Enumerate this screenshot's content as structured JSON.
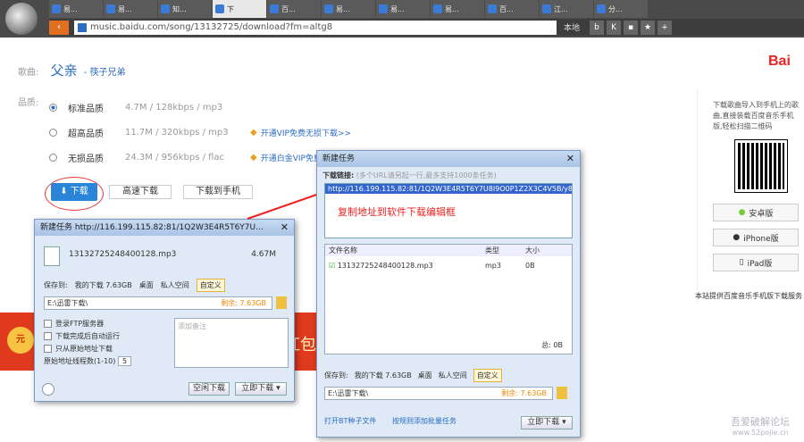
{
  "browser": {
    "url": "music.baidu.com/song/13132725/download?fm=altg8",
    "tabs": [
      "易...",
      "易...",
      "知...",
      "下",
      "百...",
      "易...",
      "易...",
      "易...",
      "百...",
      "江...",
      "分..."
    ],
    "search_hint": "本地"
  },
  "song": {
    "label": "歌曲:",
    "title": "父亲",
    "artist": "筷子兄弟",
    "quality_label": "品质:"
  },
  "qualities": [
    {
      "name": "标准品质",
      "info": "4.7M / 128kbps / mp3",
      "vip": ""
    },
    {
      "name": "超高品质",
      "info": "11.7M / 320kbps / mp3",
      "vip": "开通VIP免费无损下载>>"
    },
    {
      "name": "无损品质",
      "info": "24.3M / 956kbps / flac",
      "vip": "开通白金VIP免费无损下载>>"
    }
  ],
  "buttons": {
    "download": "下载",
    "batch": "高速下载",
    "phone": "下载到手机"
  },
  "sidebar": {
    "text": "下载歌曲导入到手机上的歌曲,直接装载百度音乐手机版,轻松扫描二维码",
    "android": "安卓版",
    "iphone": "iPhone版",
    "ipad": "iPad版",
    "note": "本站提供百度音乐手机版下载服务"
  },
  "dlg1": {
    "title": "新建任务 http://116.199.115.82:81/1Q2W3E4R5T6Y7U...",
    "filename": "13132725248400128.mp3",
    "size": "4.67M",
    "saveto": "保存到:",
    "opt1": "我的下载 7.63GB",
    "opt2": "桌面",
    "opt3": "私人空间",
    "opt4": "自定义",
    "path": "E:\\迅雷下载\\",
    "free": "剩余: 7.63GB",
    "cb1": "登录FTP服务器",
    "cb2": "下载完成后自动运行",
    "cb3": "只从原始地址下载",
    "threads_label": "原始地址线程数(1-10)",
    "threads": "5",
    "note_ph": "添加备注",
    "btn_later": "空闲下载",
    "btn_now": "立即下载"
  },
  "dlg2": {
    "title": "新建任务",
    "url_label": "下载链接:",
    "url_hint": "(多个URL请另起一行,最多支持1000条任务)",
    "url": "http://116.199.115.82:81/1Q2W3E4R5T6Y7U8I9O0P1Z2X3C4V5B/y8...",
    "annotation": "复制地址到软件下载编辑框",
    "col_name": "文件名称",
    "col_type": "类型",
    "col_size": "大小",
    "row_name": "13132725248400128.mp3",
    "row_type": "mp3",
    "row_size": "0B",
    "total": "总: 0B",
    "saveto": "保存到:",
    "opt1": "我的下载 7.63GB",
    "opt2": "桌面",
    "opt3": "私人空间",
    "opt4": "自定义",
    "path": "E:\\迅雷下载\\",
    "free": "剩余: 7.63GB",
    "link1": "打开BT种子文件",
    "link2": "按规则添加批量任务",
    "btn_now": "立即下载"
  },
  "banner": {
    "text": "红包"
  },
  "watermark": {
    "line1": "吾爱破解论坛",
    "line2": "www.52pojie.cn"
  },
  "colors": {
    "accent": "#2a6cc4",
    "red": "#e22",
    "chrome": "#4a4a4a"
  }
}
